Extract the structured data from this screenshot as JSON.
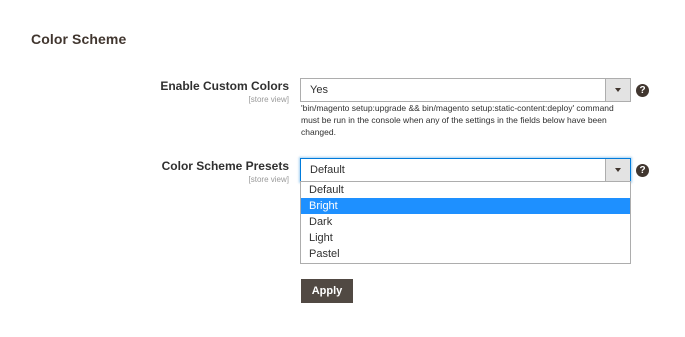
{
  "section": {
    "title": "Color Scheme"
  },
  "enable_custom_colors": {
    "label": "Enable Custom Colors",
    "scope": "[store view]",
    "value": "Yes",
    "note": "'bin/magento setup:upgrade && bin/magento setup:static-content:deploy' command must be run in the console when any of the settings in the fields below have been changed.",
    "help": "?"
  },
  "color_scheme_presets": {
    "label": "Color Scheme Presets",
    "scope": "[store view]",
    "value": "Default",
    "help": "?",
    "options": [
      "Default",
      "Bright",
      "Dark",
      "Light",
      "Pastel"
    ],
    "highlighted_option": "Bright"
  },
  "apply_button": {
    "label": "Apply"
  },
  "colors": {
    "accent": "#1e90ff",
    "button_bg": "#514943",
    "focus_border": "#007bdb"
  }
}
